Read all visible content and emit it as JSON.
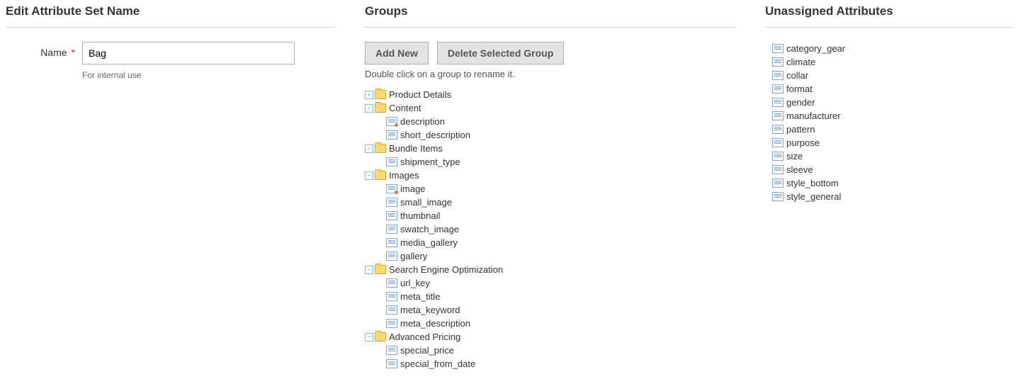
{
  "edit": {
    "section_title": "Edit Attribute Set Name",
    "name_label": "Name",
    "name_value": "Bag",
    "name_hint": "For internal use"
  },
  "groups": {
    "section_title": "Groups",
    "add_button": "Add New",
    "delete_button": "Delete Selected Group",
    "help": "Double click on a group to rename it.",
    "tree": [
      {
        "label": "Product Details",
        "expanded": false,
        "children": []
      },
      {
        "label": "Content",
        "expanded": true,
        "children": [
          {
            "label": "description",
            "sys": true
          },
          {
            "label": "short_description",
            "sys": false
          }
        ]
      },
      {
        "label": "Bundle Items",
        "expanded": true,
        "children": [
          {
            "label": "shipment_type",
            "sys": false
          }
        ]
      },
      {
        "label": "Images",
        "expanded": true,
        "children": [
          {
            "label": "image",
            "sys": true
          },
          {
            "label": "small_image",
            "sys": false
          },
          {
            "label": "thumbnail",
            "sys": false
          },
          {
            "label": "swatch_image",
            "sys": false
          },
          {
            "label": "media_gallery",
            "sys": false
          },
          {
            "label": "gallery",
            "sys": false
          }
        ]
      },
      {
        "label": "Search Engine Optimization",
        "expanded": true,
        "children": [
          {
            "label": "url_key",
            "sys": false
          },
          {
            "label": "meta_title",
            "sys": false
          },
          {
            "label": "meta_keyword",
            "sys": false
          },
          {
            "label": "meta_description",
            "sys": false
          }
        ]
      },
      {
        "label": "Advanced Pricing",
        "expanded": true,
        "children": [
          {
            "label": "special_price",
            "sys": false
          },
          {
            "label": "special_from_date",
            "sys": false
          }
        ]
      }
    ]
  },
  "unassigned": {
    "section_title": "Unassigned Attributes",
    "items": [
      "category_gear",
      "climate",
      "collar",
      "format",
      "gender",
      "manufacturer",
      "pattern",
      "purpose",
      "size",
      "sleeve",
      "style_bottom",
      "style_general"
    ]
  }
}
